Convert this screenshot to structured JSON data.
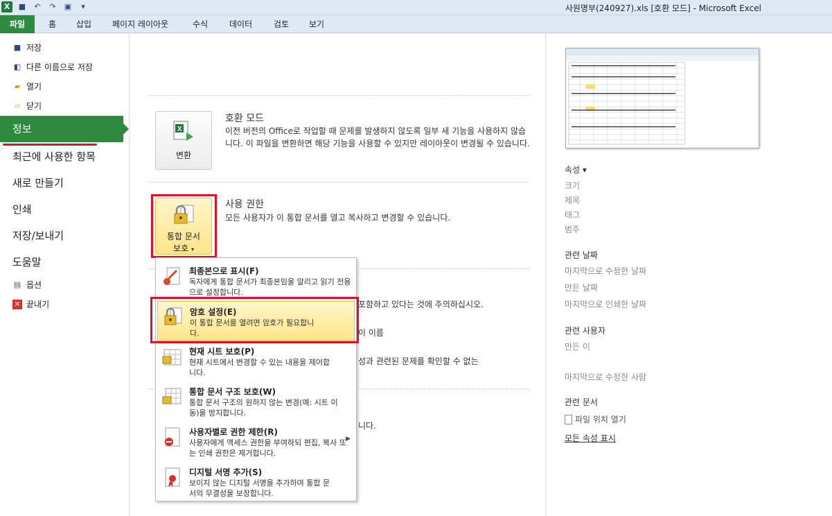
{
  "window": {
    "title": "사원명부(240927).xls  [호환 모드]  -  Microsoft Excel"
  },
  "ribbon": {
    "tabs": [
      "파일",
      "홈",
      "삽입",
      "페이지 레이아웃",
      "수식",
      "데이터",
      "검토",
      "보기"
    ]
  },
  "nav": {
    "small_top": [
      {
        "label": "저장",
        "icon": "save-icon"
      },
      {
        "label": "다른 이름으로 저장",
        "icon": "save-as-icon"
      },
      {
        "label": "열기",
        "icon": "open-folder-icon"
      },
      {
        "label": "닫기",
        "icon": "close-folder-icon"
      }
    ],
    "info": "정보",
    "big": [
      "최근에 사용한 항목",
      "새로 만들기",
      "인쇄",
      "저장/보내기",
      "도움말"
    ],
    "small_bottom": [
      {
        "label": "옵션",
        "icon": "options-icon"
      },
      {
        "label": "끝내기",
        "icon": "exit-icon"
      }
    ]
  },
  "compat": {
    "button": "변환",
    "title": "호환 모드",
    "text": "이전 버전의 Office로 작업할 때 문제를 발생하지 않도록 일부 새 기능을 사용하지 않습니다. 이 파일을 변환하면 해당 기능을 사용할 수 있지만 레이아웃이 변경될 수 있습니다."
  },
  "permissions": {
    "button_line1": "통합 문서",
    "button_line2": "보호",
    "title": "사용 권한",
    "text": "모든 사용자가 이 통합 문서를 열고 복사하고 변경할 수 있습니다."
  },
  "menu": {
    "items": [
      {
        "title": "최종본으로 표시(F)",
        "desc": "독자에게 통합 문서가 최종본임을 알리고 읽기 전용으로 설정합니다."
      },
      {
        "title": "암호 설정(E)",
        "desc": "이 통합 문서를 열려면 암호가 필요합니다."
      },
      {
        "title": "현재 시트 보호(P)",
        "desc": "현재 시트에서 변경할 수 있는 내용을 제어합니다."
      },
      {
        "title": "통합 문서 구조 보호(W)",
        "desc": "통합 문서 구조의 원하지 않는 변경(예: 시트 이동)을 방지합니다."
      },
      {
        "title": "사용자별로 권한 제한(R)",
        "desc": "사용자에게 액세스 권한을 부여하되 편집, 복사 또는 인쇄 권한은 제거합니다."
      },
      {
        "title": "디지털 서명 추가(S)",
        "desc": "보이지 않는 디지털 서명을 추가하여 통합 문서의 무결성을 보장합니다."
      }
    ]
  },
  "bleed": {
    "line1": "포함하고 있다는 것에 주의하십시오.",
    "line2": "이 이름",
    "line3": "성과 관련된 문제를 확인할 수 없는",
    "line4": "니다."
  },
  "properties": {
    "header": "속성 ▾",
    "props": [
      "크기",
      "제목",
      "태그",
      "범주"
    ],
    "dates_header": "관련 날짜",
    "dates": [
      "마지막으로 수정한 날짜",
      "만든 날짜",
      "마지막으로 인쇄한 날짜"
    ],
    "people_header": "관련 사용자",
    "people": [
      "만든 이",
      "마지막으로 수정한 사람"
    ],
    "docs_header": "관련 문서",
    "open_location": "파일 위치 열기",
    "show_all": "모든 속성 표시"
  }
}
